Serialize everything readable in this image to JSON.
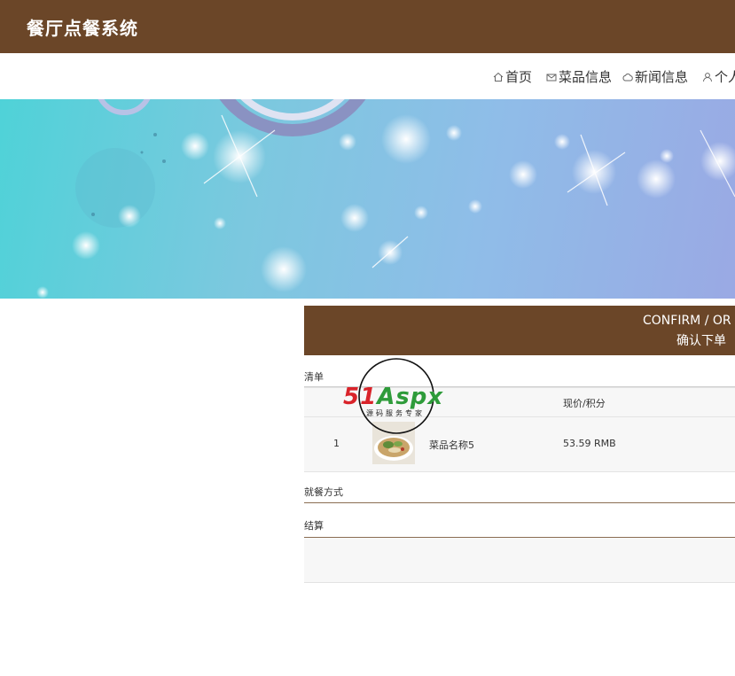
{
  "header": {
    "site_title": "餐厅点餐系统"
  },
  "nav": {
    "items": [
      {
        "label": "首页",
        "icon": "home-icon"
      },
      {
        "label": "菜品信息",
        "icon": "envelope-icon"
      },
      {
        "label": "新闻信息",
        "icon": "cloud-icon"
      },
      {
        "label": "个人",
        "icon": "user-icon"
      }
    ]
  },
  "content_header": {
    "title_en": "CONFIRM / OR",
    "title_zh": "确认下单"
  },
  "order_list": {
    "section_label": "清单",
    "columns": [
      "现价/积分"
    ],
    "rows": [
      {
        "index": "1",
        "name": "菜品名称5",
        "price": "53.59 RMB"
      }
    ]
  },
  "dining_method": {
    "label": "就餐方式"
  },
  "settlement": {
    "label": "结算"
  },
  "watermark": {
    "brand": "51Aspx",
    "brand_a": "51",
    "brand_b": "Aspx",
    "tagline": "源码服务专家"
  },
  "colors": {
    "brand_brown": "#6b4628",
    "panel_bg": "#f7f7f7",
    "watermark_red": "#d9232a",
    "watermark_green": "#2e9b3a"
  }
}
